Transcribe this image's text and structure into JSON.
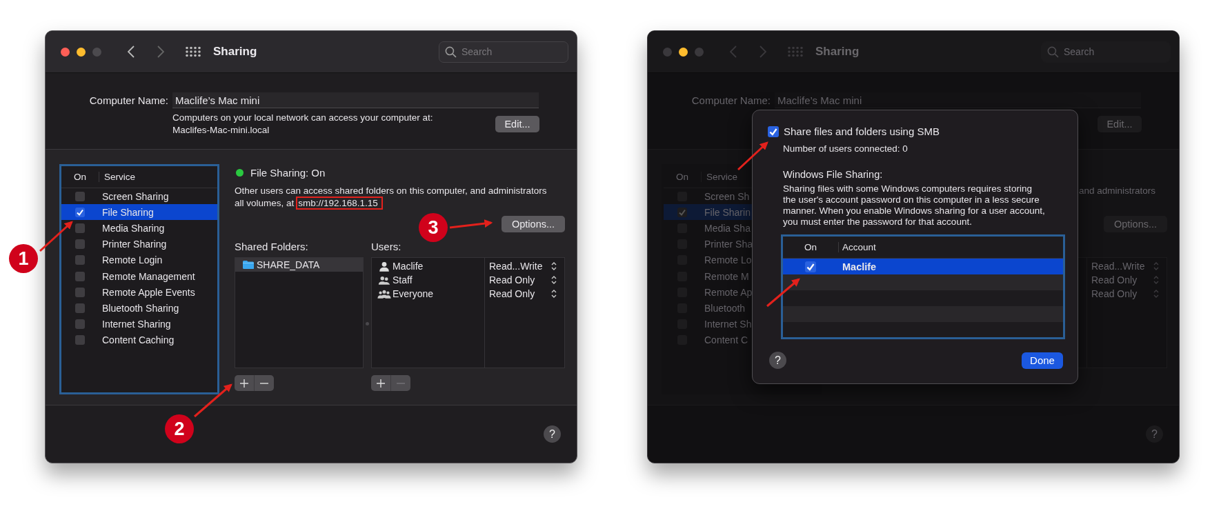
{
  "main_window": {
    "title": "Sharing",
    "search": {
      "placeholder": "Search"
    },
    "computer_name": {
      "label": "Computer Name:",
      "value": "Maclife’s Mac mini",
      "note_lines": [
        "Computers on your local network can access your computer at:",
        "Maclifes-Mac-mini.local"
      ],
      "edit_button": "Edit..."
    },
    "services": {
      "columns": [
        "On",
        "Service"
      ],
      "rows": [
        {
          "name": "Screen Sharing",
          "checked": false,
          "selected": false
        },
        {
          "name": "File Sharing",
          "checked": true,
          "selected": true
        },
        {
          "name": "Media Sharing",
          "checked": false,
          "selected": false
        },
        {
          "name": "Printer Sharing",
          "checked": false,
          "selected": false
        },
        {
          "name": "Remote Login",
          "checked": false,
          "selected": false
        },
        {
          "name": "Remote Management",
          "checked": false,
          "selected": false
        },
        {
          "name": "Remote Apple Events",
          "checked": false,
          "selected": false
        },
        {
          "name": "Bluetooth Sharing",
          "checked": false,
          "selected": false
        },
        {
          "name": "Internet Sharing",
          "checked": false,
          "selected": false
        },
        {
          "name": "Content Caching",
          "checked": false,
          "selected": false
        }
      ]
    },
    "status": {
      "text": "File Sharing: On",
      "color": "#2ac940"
    },
    "description_lines": [
      "Other users can access shared folders on this computer, and administrators",
      "all volumes, at"
    ],
    "address": "smb://192.168.1.15",
    "options_button": "Options...",
    "shared_folders": {
      "label": "Shared Folders:",
      "items": [
        {
          "name": "SHARE_DATA",
          "selected": true
        }
      ],
      "remove_disabled": false
    },
    "users": {
      "label": "Users:",
      "items": [
        {
          "name": "Maclife",
          "kind": "person",
          "permission": "Read...Write"
        },
        {
          "name": "Staff",
          "kind": "group",
          "permission": "Read Only"
        },
        {
          "name": "Everyone",
          "kind": "everyone",
          "permission": "Read Only"
        }
      ],
      "remove_disabled": true
    },
    "help": "?"
  },
  "dimmed_window": {
    "title": "Sharing",
    "search": {
      "placeholder": "Search"
    },
    "computer_name": {
      "label": "Computer Name:",
      "value": "Maclife’s Mac mini",
      "edit_button": "Edit..."
    },
    "services": {
      "columns": [
        "On",
        "Service"
      ],
      "rows": [
        {
          "name": "Screen Sh",
          "checked": false,
          "selected": false
        },
        {
          "name": "File Sharin",
          "checked": true,
          "selected": true
        },
        {
          "name": "Media Sha",
          "checked": false,
          "selected": false
        },
        {
          "name": "Printer Sha",
          "checked": false,
          "selected": false
        },
        {
          "name": "Remote Lo",
          "checked": false,
          "selected": false
        },
        {
          "name": "Remote M",
          "checked": false,
          "selected": false
        },
        {
          "name": "Remote Ap",
          "checked": false,
          "selected": false
        },
        {
          "name": "Bluetooth",
          "checked": false,
          "selected": false
        },
        {
          "name": "Internet Sh",
          "checked": false,
          "selected": false
        },
        {
          "name": "Content C",
          "checked": false,
          "selected": false
        }
      ]
    },
    "description_fragment": "and administrators",
    "options_button": "Options...",
    "permissions": [
      "Read...Write",
      "Read Only",
      "Read Only"
    ],
    "help": "?"
  },
  "options_dialog": {
    "smb": {
      "label": "Share files and folders using SMB",
      "checked": true
    },
    "users_connected": "Number of users connected: 0",
    "windows_heading": "Windows File Sharing:",
    "windows_note_lines": [
      "Sharing files with some Windows computers requires storing",
      "the user's account password on this computer in a less secure",
      "manner. When you enable Windows sharing for a user account,",
      "you must enter the password for that account."
    ],
    "accounts": {
      "columns": [
        "On",
        "Account"
      ],
      "rows": [
        {
          "name": "Maclife",
          "checked": true,
          "selected": true
        }
      ]
    },
    "help": "?",
    "done_button": "Done"
  },
  "annotations": {
    "markers": [
      {
        "label": "1"
      },
      {
        "label": "2"
      },
      {
        "label": "3"
      }
    ]
  }
}
